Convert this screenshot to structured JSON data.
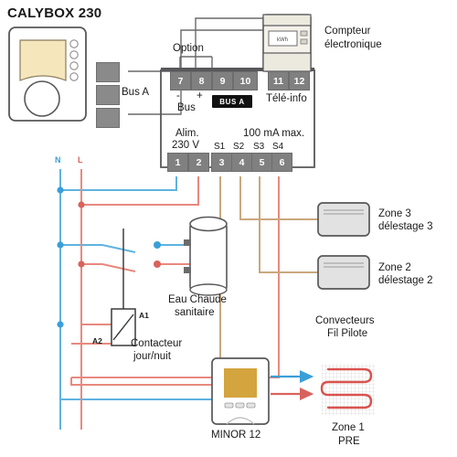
{
  "diagram": {
    "title": "CALYBOX 230",
    "type": "electrical-wiring-diagram",
    "language": "fr"
  },
  "devices": {
    "calybox": {
      "name": "CALYBOX 230",
      "screen_color": "#f6e6bc",
      "buttons": 4
    },
    "bus_terminal": {
      "label": "Bus A",
      "blocks": 3
    },
    "meter": {
      "label_line1": "Compteur",
      "label_line2": "électronique",
      "display_text": "kWh"
    },
    "water_heater": {
      "label_line1": "Eau Chaude",
      "label_line2": "sanitaire"
    },
    "contactor": {
      "label_line1": "Contacteur",
      "label_line2": "jour/nuit",
      "coil_a1": "A1",
      "coil_a2": "A2"
    },
    "thermostat": {
      "label": "MINOR 12",
      "screen_color": "#d4a43f"
    },
    "convectors": {
      "caption_line1": "Convecteurs",
      "caption_line2": "Fil Pilote"
    },
    "zone3": {
      "line1": "Zone 3",
      "line2": "délestage 3"
    },
    "zone2": {
      "line1": "Zone 2",
      "line2": "délestage 2"
    },
    "zone1": {
      "line1": "Zone 1",
      "line2": "PRE"
    }
  },
  "terminals": {
    "option_label": "Option",
    "bus_minus": "-",
    "bus_plus": "+",
    "bus_word": "Bus",
    "bus_badge": "BUS A",
    "teleinfo_label": "Télé-info",
    "alim_line1": "Alim.",
    "alim_line2": "230 V",
    "current_label": "100 mA max.",
    "top_row": [
      "7",
      "8",
      "9",
      "10",
      "11",
      "12"
    ],
    "bottom_row": [
      "1",
      "2",
      "3",
      "4",
      "5",
      "6"
    ],
    "s_labels": [
      "S1",
      "S2",
      "S3",
      "S4"
    ]
  },
  "mains": {
    "neutral": "N",
    "live": "L",
    "neutral_color": "#5fb3e0",
    "live_color": "#e8897f"
  },
  "colors": {
    "terminal_gray": "#808080",
    "pilot_wire": "#c9a87c",
    "neutral_blue": "#5fb3e0",
    "live_red": "#e8897f",
    "outline": "#58585a",
    "heating_red": "#d9534f"
  }
}
